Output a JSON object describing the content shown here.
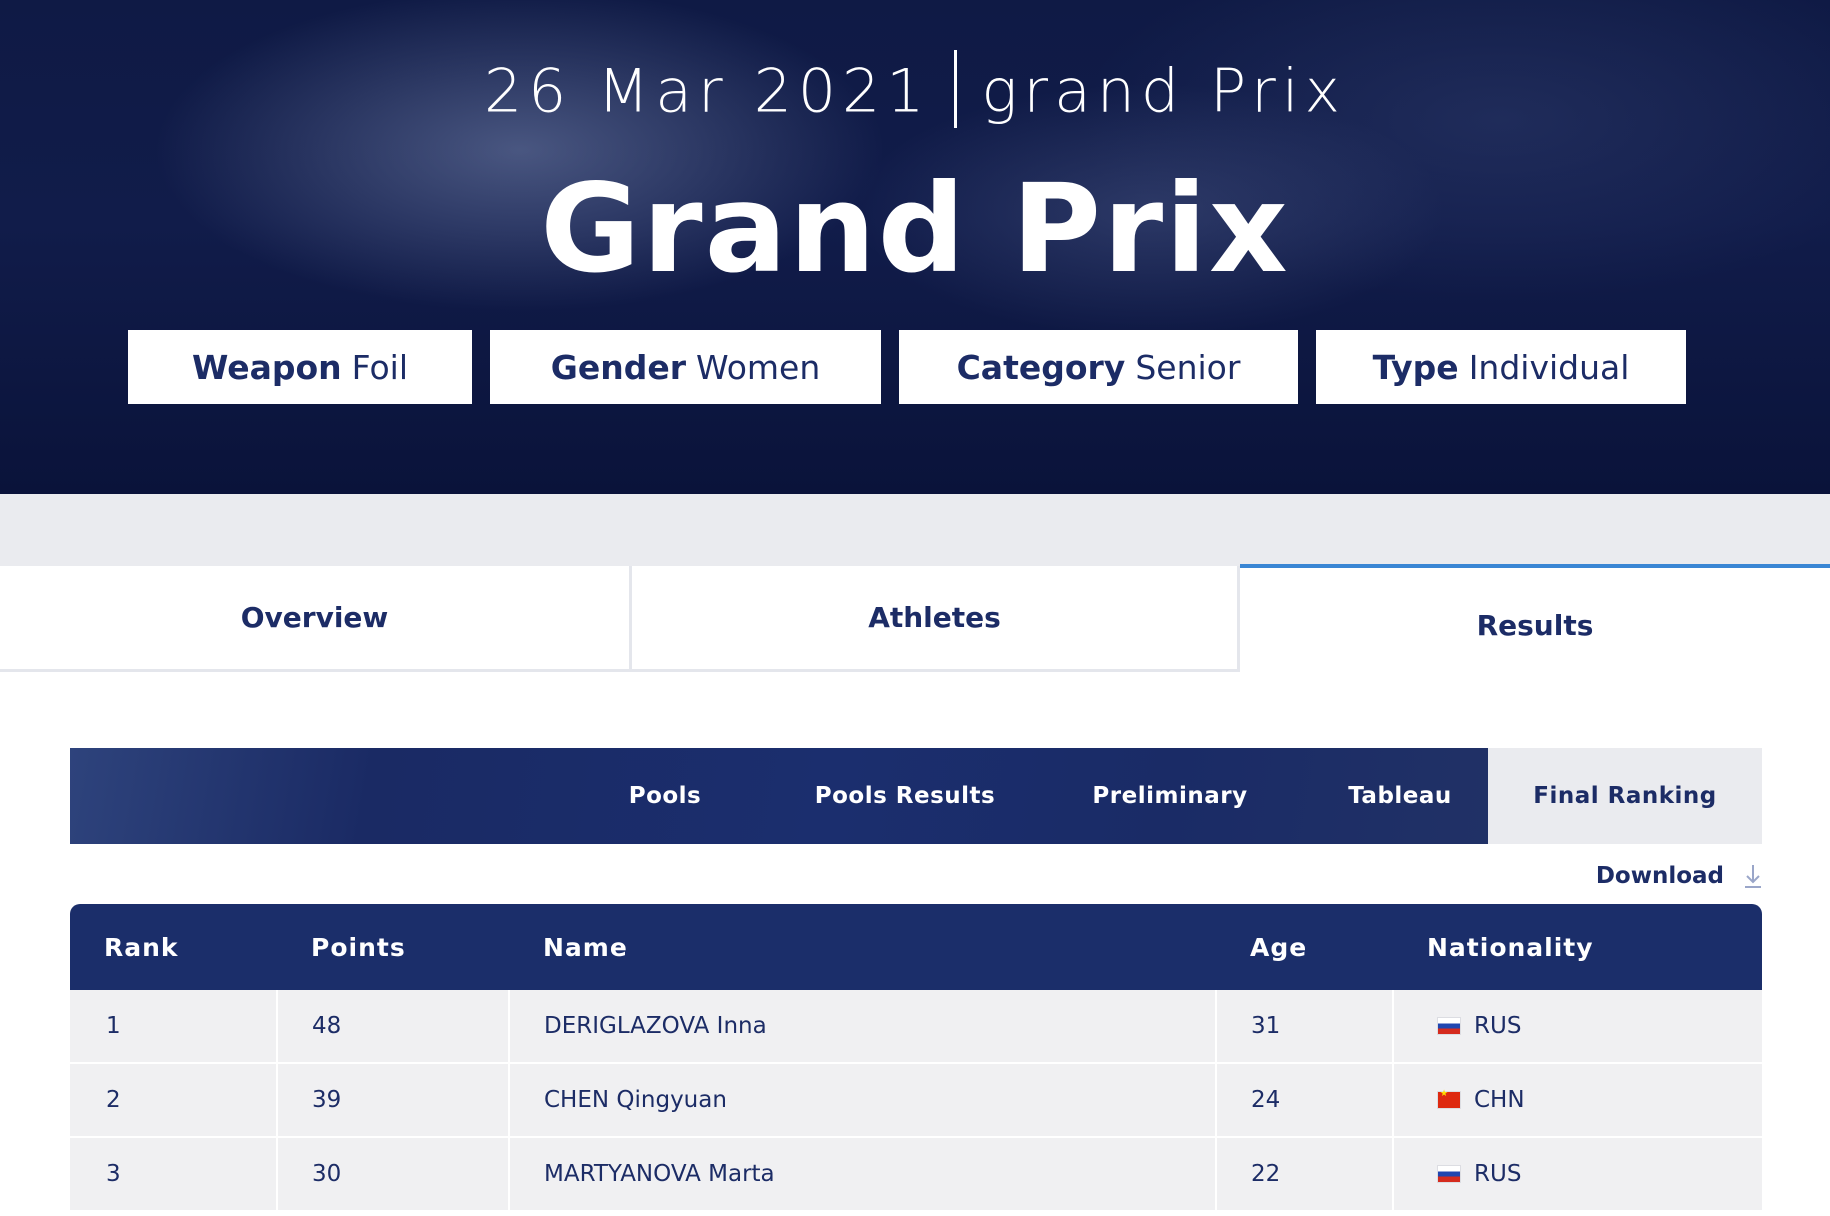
{
  "hero": {
    "date": "26 Mar 2021",
    "subtitle": "grand Prix",
    "title": "Grand Prix",
    "filters": [
      {
        "key": "Weapon",
        "value": "Foil"
      },
      {
        "key": "Gender",
        "value": "Women"
      },
      {
        "key": "Category",
        "value": "Senior"
      },
      {
        "key": "Type",
        "value": "Individual"
      }
    ]
  },
  "tabs": [
    {
      "label": "Overview",
      "active": false
    },
    {
      "label": "Athletes",
      "active": false
    },
    {
      "label": "Results",
      "active": true
    }
  ],
  "subnav": [
    {
      "label": "Pools",
      "active": false
    },
    {
      "label": "Pools Results",
      "active": false
    },
    {
      "label": "Preliminary",
      "active": false
    },
    {
      "label": "Tableau",
      "active": false
    },
    {
      "label": "Final Ranking",
      "active": true
    }
  ],
  "download_label": "Download",
  "table": {
    "headers": [
      "Rank",
      "Points",
      "Name",
      "Age",
      "Nationality"
    ],
    "rows": [
      {
        "rank": "1",
        "points": "48",
        "name": "DERIGLAZOVA Inna",
        "age": "31",
        "nationality": "RUS",
        "flag": "flag-rus"
      },
      {
        "rank": "2",
        "points": "39",
        "name": "CHEN Qingyuan",
        "age": "24",
        "nationality": "CHN",
        "flag": "flag-chn"
      },
      {
        "rank": "3",
        "points": "30",
        "name": "MARTYANOVA Marta",
        "age": "22",
        "nationality": "RUS",
        "flag": "flag-rus"
      }
    ]
  },
  "colors": {
    "navy": "#1b2e6a",
    "text": "#1c2c66",
    "accent_blue": "#3a86d4",
    "band_grey": "#eaebef",
    "row_grey": "#f0f0f2"
  }
}
